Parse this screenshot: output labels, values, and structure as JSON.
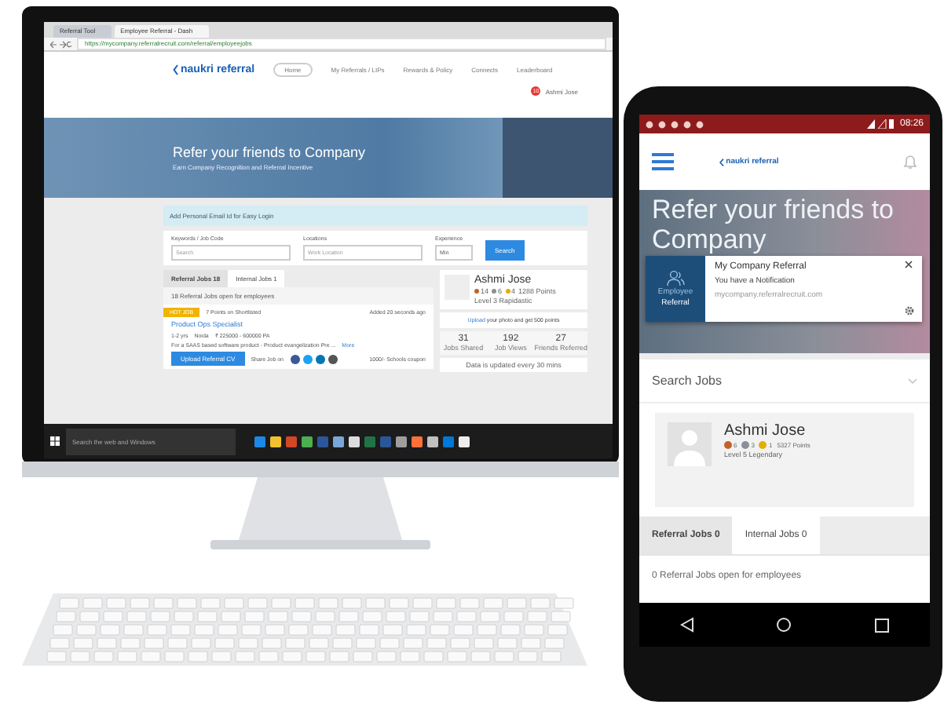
{
  "desktop": {
    "browser_tabs": [
      {
        "label": "Referral Tool",
        "selected": false
      },
      {
        "label": "Employee Referral - Dash",
        "selected": true
      }
    ],
    "url": "https://mycompany.referralrecruit.com/referral/employeejobs",
    "logo": "naukri referral",
    "nav": [
      {
        "label": "Home",
        "selected": true
      },
      {
        "label": "My Referrals / LIPs",
        "selected": false
      },
      {
        "label": "Rewards & Policy",
        "selected": false
      },
      {
        "label": "Connects",
        "selected": false
      },
      {
        "label": "Leaderboard",
        "selected": false
      }
    ],
    "notification_count": "10",
    "user": "Ashmi Jose",
    "hero": {
      "title": "Refer your friends to Company",
      "subtitle": "Earn Company Recognition and Referral Incentive"
    },
    "info_bar": "Add Personal Email Id for Easy Login",
    "search": {
      "fields": [
        {
          "label": "Keywords / Job Code",
          "placeholder": "Search"
        },
        {
          "label": "Locations",
          "placeholder": "Work Location"
        }
      ],
      "experience_label": "Experience",
      "experience_value": "Min",
      "button": "Search"
    },
    "job_tabs": [
      {
        "label": "Referral Jobs 18",
        "selected": true
      },
      {
        "label": "Internal Jobs 1",
        "selected": false
      }
    ],
    "jobs_count": "18 Referral Jobs open for employees",
    "job": {
      "badge": "HOT JOB",
      "points": "7 Points on Shortlisted",
      "added": "Added 20 seconds ago",
      "title": "Product Ops Specialist",
      "experience": "1-2 yrs",
      "location": "Noida",
      "salary": "₹ 225000 - 600000 PA",
      "description": "For a SAAS based software product - Product evangelization Pre ...",
      "more": "More",
      "upload": "Upload Referral CV",
      "share": "Share Job on",
      "coupon": "1000/- Schools coupon"
    },
    "profile": {
      "name": "Ashmi Jose",
      "badges": [
        {
          "count": "14",
          "color": "#c0622a"
        },
        {
          "count": "6",
          "color": "#8a8f99"
        },
        {
          "count": "4",
          "color": "#e0b000"
        }
      ],
      "points": "1288 Points",
      "level": "Level 3 Rapidastic",
      "upload_link": "Upload",
      "upload_text": "your photo and get 500 points",
      "stats": [
        {
          "value": "31",
          "label": "Jobs Shared"
        },
        {
          "value": "192",
          "label": "Job Views"
        },
        {
          "value": "27",
          "label": "Friends Referred"
        }
      ],
      "updated": "Data is updated every 30 mins"
    },
    "taskbar": {
      "search_placeholder": "Search the web and Windows"
    }
  },
  "phone": {
    "time": "08:26",
    "logo": "naukri referral",
    "hero_title": "Refer your friends to Company",
    "notification": {
      "icon_top": "Employee",
      "icon_bottom": "Referral",
      "title": "My Company Referral",
      "message": "You have a Notification",
      "site": "mycompany.referralrecruit.com"
    },
    "search_jobs": "Search Jobs",
    "profile": {
      "name": "Ashmi Jose",
      "badges": [
        {
          "count": "6",
          "color": "#c0622a"
        },
        {
          "count": "3",
          "color": "#8a8f99"
        },
        {
          "count": "1",
          "color": "#e0b000"
        }
      ],
      "points": "5327 Points",
      "level": "Level 5 Legendary"
    },
    "job_tabs": [
      {
        "label": "Referral Jobs 0",
        "selected": true
      },
      {
        "label": "Internal Jobs 0",
        "selected": false
      }
    ],
    "jobs_count": "0 Referral Jobs open for employees"
  }
}
